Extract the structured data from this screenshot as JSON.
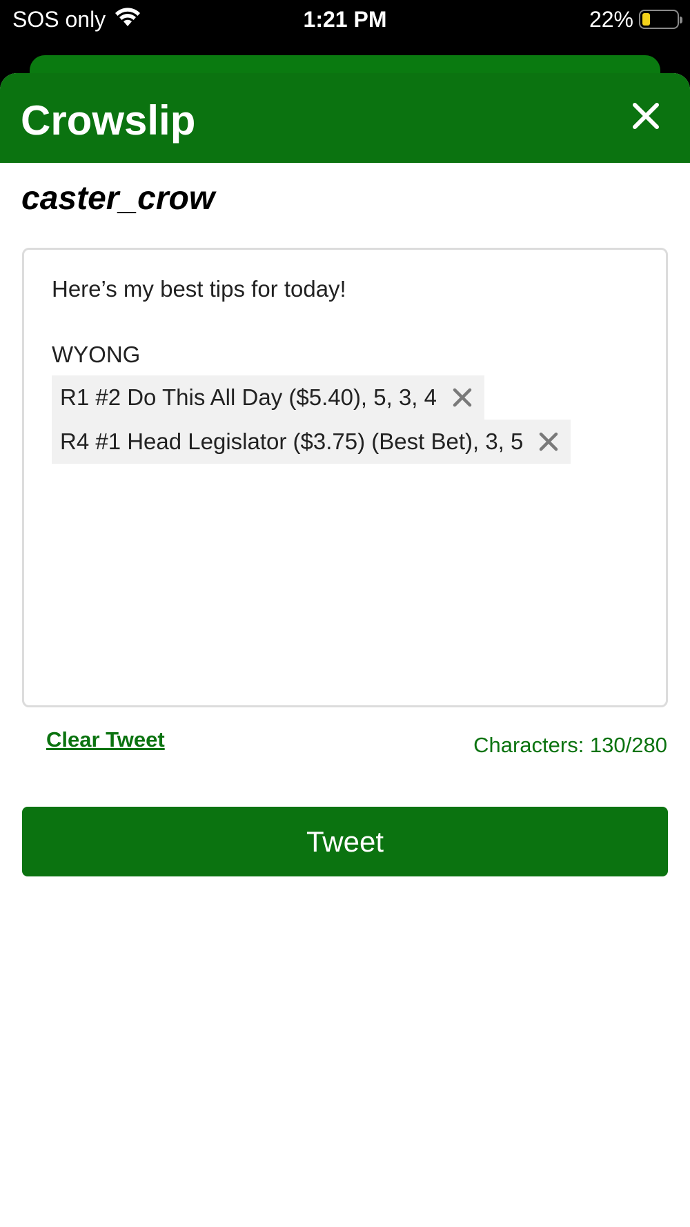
{
  "status_bar": {
    "carrier": "SOS only",
    "time": "1:21 PM",
    "battery_percent": "22%",
    "battery_level": 0.22,
    "battery_color": "#f4d21a"
  },
  "header": {
    "title": "Crowslip",
    "close_icon": "close-icon",
    "color": "#0b7310"
  },
  "user": {
    "username": "caster_crow"
  },
  "tweet": {
    "intro": "Here’s my best tips for today!",
    "track": "WYONG",
    "tips": [
      {
        "label": "R1 #2 Do This All Day ($5.40), 5, 3, 4",
        "remove_icon": "remove-icon"
      },
      {
        "label": "R4 #1 Head Legislator ($3.75) (Best Bet), 3, 5",
        "remove_icon": "remove-icon"
      }
    ]
  },
  "actions": {
    "clear_label": "Clear Tweet",
    "char_count": "Characters: 130/280",
    "tweet_label": "Tweet"
  }
}
